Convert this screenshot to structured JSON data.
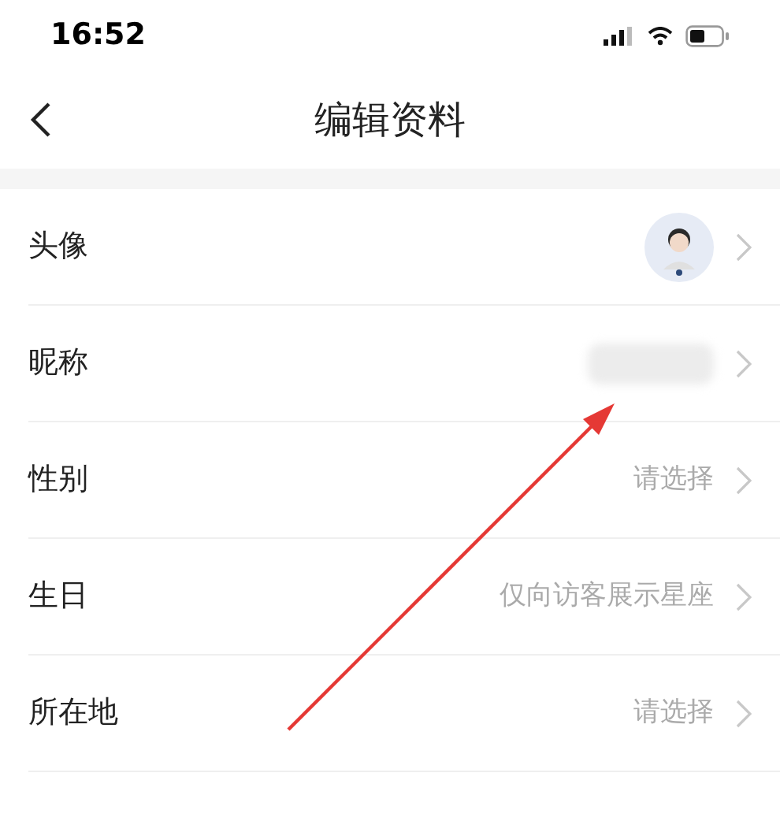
{
  "status_bar": {
    "time": "16:52"
  },
  "nav": {
    "title": "编辑资料"
  },
  "rows": [
    {
      "kind": "avatar",
      "label": "头像"
    },
    {
      "kind": "blurred",
      "label": "昵称"
    },
    {
      "kind": "text",
      "label": "性别",
      "value": "请选择"
    },
    {
      "kind": "text",
      "label": "生日",
      "value": "仅向访客展示星座"
    },
    {
      "kind": "text",
      "label": "所在地",
      "value": "请选择"
    }
  ],
  "annotation": {
    "kind": "arrow"
  }
}
